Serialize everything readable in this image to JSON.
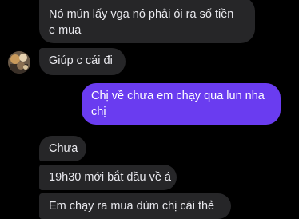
{
  "conversation": {
    "messages": [
      {
        "sender": "contact",
        "lines": [
          "Nó mún lấy vga nó phải ói ra số tiền",
          "e mua"
        ]
      },
      {
        "sender": "contact",
        "lines": [
          "Giúp c cái đi"
        ]
      },
      {
        "sender": "me",
        "lines": [
          "Chị về chưa em chạy qua lun nha",
          "chị"
        ]
      },
      {
        "sender": "contact",
        "lines": [
          "Chưa"
        ]
      },
      {
        "sender": "contact",
        "lines": [
          "19h30 mới bắt đầu về á"
        ]
      },
      {
        "sender": "contact",
        "lines": [
          "Em chạy ra mua dùm chị cái thẻ"
        ]
      }
    ]
  },
  "colors": {
    "background": "#000000",
    "incoming_bubble": "#262628",
    "outgoing_bubble": "#6a3cf0",
    "text": "#e9e9ee"
  },
  "avatar": {
    "icon": "contact-avatar-photo"
  }
}
